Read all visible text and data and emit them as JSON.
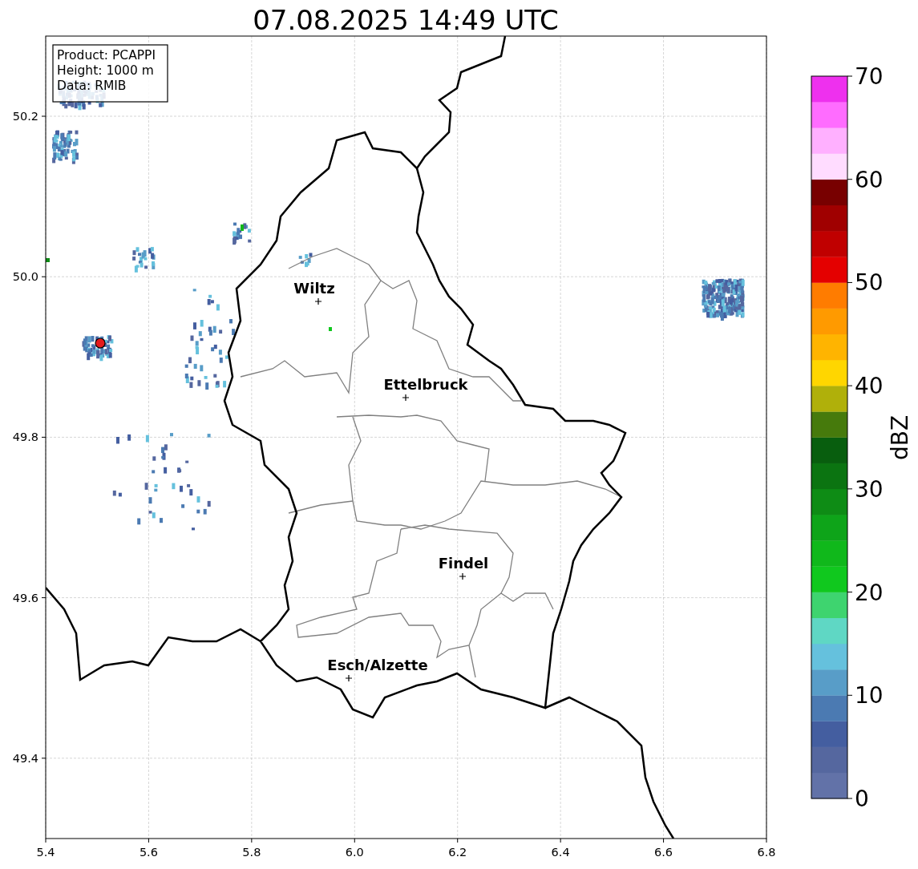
{
  "title": "07.08.2025 14:49 UTC",
  "info_box": [
    "Product: PCAPPI",
    "Height: 1000 m",
    "Data: RMIB"
  ],
  "cities": [
    {
      "name": "Wiltz"
    },
    {
      "name": "Ettelbruck"
    },
    {
      "name": "Findel"
    },
    {
      "name": "Esch/Alzette"
    }
  ],
  "x_ticks": [
    "5.4",
    "5.6",
    "5.8",
    "6.0",
    "6.2",
    "6.4",
    "6.6",
    "6.8"
  ],
  "y_ticks": [
    "50.2",
    "50.0",
    "49.8",
    "49.6",
    "49.4"
  ],
  "colorbar": {
    "label": "dBZ",
    "ticks": [
      "70",
      "60",
      "50",
      "40",
      "30",
      "20",
      "10",
      "0"
    ],
    "bands": [
      {
        "color": "#6272a8"
      },
      {
        "color": "#55679f"
      },
      {
        "color": "#445ea0"
      },
      {
        "color": "#4b7ab2"
      },
      {
        "color": "#589dc8"
      },
      {
        "color": "#65c1dd"
      },
      {
        "color": "#5fd7c4"
      },
      {
        "color": "#3ed46f"
      },
      {
        "color": "#10c81e"
      },
      {
        "color": "#10b81b"
      },
      {
        "color": "#0ea419"
      },
      {
        "color": "#0e8c15"
      },
      {
        "color": "#0b7411"
      },
      {
        "color": "#085e0e"
      },
      {
        "color": "#467a0c"
      },
      {
        "color": "#b0b00a"
      },
      {
        "color": "#ffd600"
      },
      {
        "color": "#ffb400"
      },
      {
        "color": "#ff9a00"
      },
      {
        "color": "#ff7c00"
      },
      {
        "color": "#e40000"
      },
      {
        "color": "#c00000"
      },
      {
        "color": "#a00000"
      },
      {
        "color": "#780000"
      },
      {
        "color": "#ffdcff"
      },
      {
        "color": "#ffb0ff"
      },
      {
        "color": "#ff6cff"
      },
      {
        "color": "#ee30ee"
      }
    ]
  }
}
